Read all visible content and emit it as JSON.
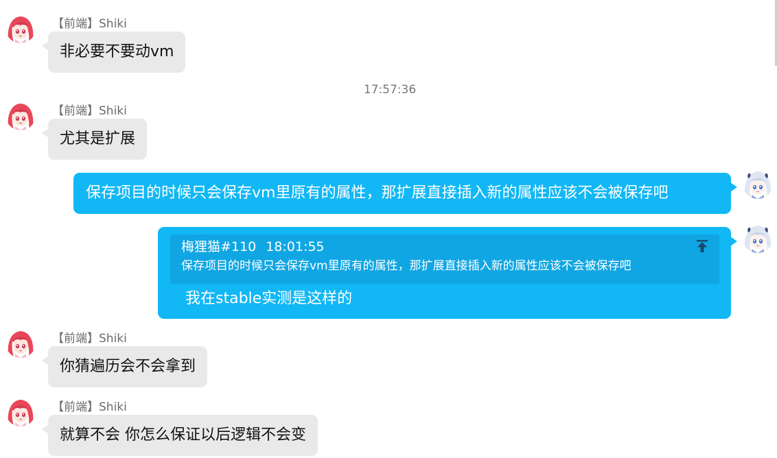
{
  "timestamp": "17:57:36",
  "messages": [
    {
      "sender": "【前端】Shiki",
      "text": "非必要不要动vm"
    },
    {
      "sender": "【前端】Shiki",
      "text": "尤其是扩展"
    },
    {
      "text": "保存项目的时候只会保存vm里原有的属性，那扩展直接插入新的属性应该不会被保存吧"
    },
    {
      "quote": {
        "author": "梅狸猫#110",
        "time": "18:01:55",
        "text": "保存项目的时候只会保存vm里原有的属性，那扩展直接插入新的属性应该不会被保存吧"
      },
      "text": "我在stable实测是这样的"
    },
    {
      "sender": "【前端】Shiki",
      "text": "你猜遍历会不会拿到"
    },
    {
      "sender": "【前端】Shiki",
      "text": "就算不会 你怎么保证以后逻辑不会变"
    }
  ],
  "colors": {
    "outgoing_bubble": "#12b7f5",
    "quote_background": "#10a6e3",
    "incoming_bubble": "#e9e9e9"
  },
  "icons": {
    "quote_jump": "arrow-up-to-top-icon",
    "avatar_incoming": "pink-hair-anime-avatar",
    "avatar_outgoing": "white-hair-anime-avatar"
  }
}
